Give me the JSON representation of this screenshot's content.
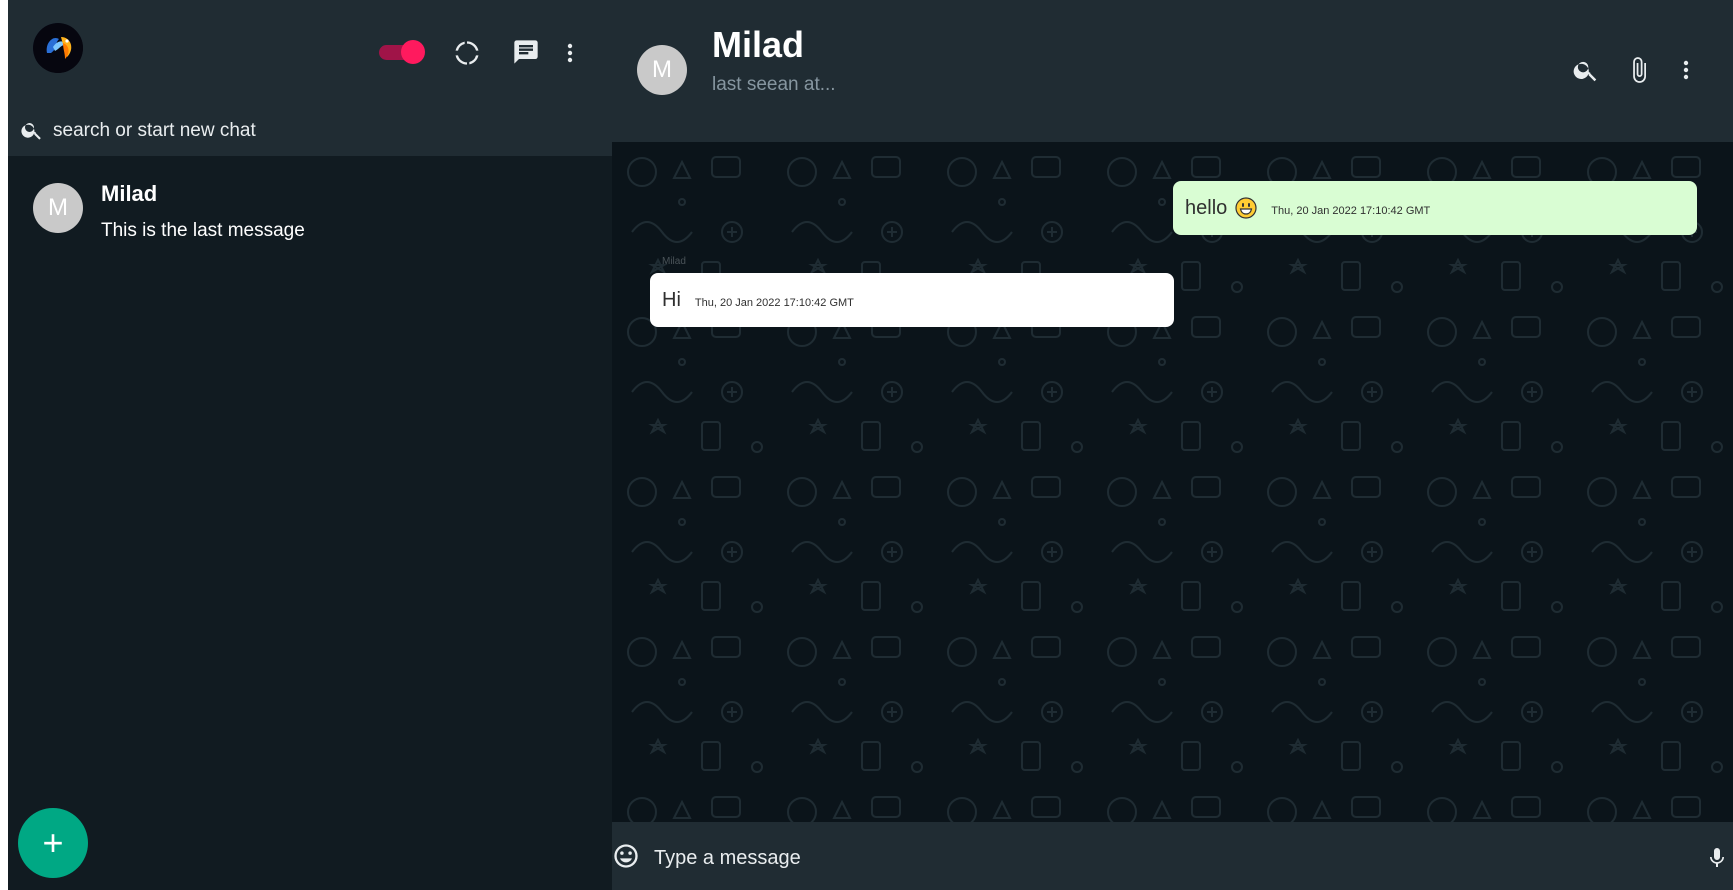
{
  "sidebar": {
    "search": {
      "placeholder": "search or start new chat"
    },
    "chats": [
      {
        "avatar_letter": "M",
        "name": "Milad",
        "last_message": "This is the last message"
      }
    ],
    "fab_label": "+",
    "toggle": {
      "on": true,
      "accent": "#ff1a5e"
    }
  },
  "chat": {
    "contact": {
      "avatar_letter": "M",
      "name": "Milad",
      "status": "last seean at..."
    },
    "messages": [
      {
        "direction": "out",
        "text": "hello",
        "emoji": "grinning-face",
        "timestamp": "Thu, 20 Jan 2022 17:10:42 GMT"
      },
      {
        "direction": "in",
        "sender": "Milad",
        "text": "Hi",
        "timestamp": "Thu, 20 Jan 2022 17:10:42 GMT"
      }
    ],
    "composer": {
      "placeholder": "Type a message"
    }
  },
  "colors": {
    "sidebar_bg": "#111b21",
    "header_bg": "#202c33",
    "chat_bg": "#0b141a",
    "outgoing_bubble": "#d9fdd3",
    "incoming_bubble": "#ffffff",
    "fab": "#00a884"
  }
}
